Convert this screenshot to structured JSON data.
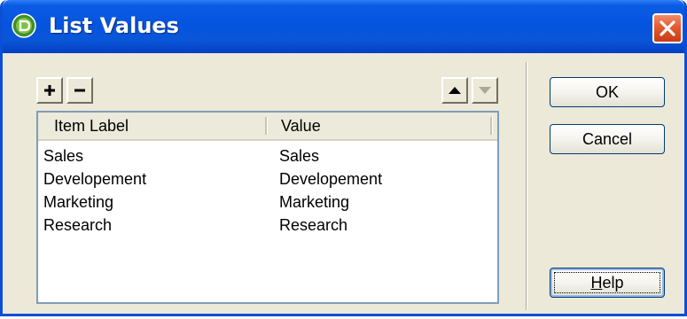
{
  "window": {
    "title": "List Values",
    "app_icon": "dreamweaver-icon",
    "close_icon": "close-icon"
  },
  "toolbar": {
    "add_icon": "plus-icon",
    "remove_icon": "minus-icon",
    "move_up_icon": "arrow-up-icon",
    "move_down_icon": "arrow-down-icon",
    "move_down_enabled": false
  },
  "list": {
    "columns": [
      "Item Label",
      "Value"
    ],
    "rows": [
      {
        "label": "Sales",
        "value": "Sales"
      },
      {
        "label": "Developement",
        "value": "Developement"
      },
      {
        "label": "Marketing",
        "value": "Marketing"
      },
      {
        "label": "Research",
        "value": "Research"
      }
    ]
  },
  "buttons": {
    "ok": "OK",
    "cancel": "Cancel",
    "help_mnemonic": "H",
    "help_rest": "elp"
  },
  "colors": {
    "titlebar": "#0554e0",
    "dialog_bg": "#ece9d8",
    "close_button": "#e55b2f",
    "list_border": "#7f9db9"
  }
}
